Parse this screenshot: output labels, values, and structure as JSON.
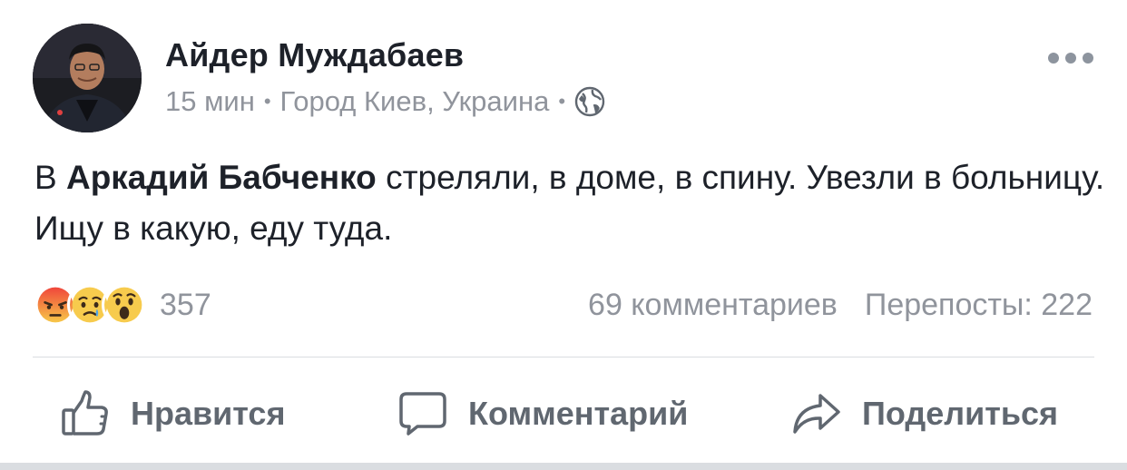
{
  "post": {
    "author": "Айдер Муждабаев",
    "time": "15 мин",
    "location": "Город Киев, Украина",
    "text_prefix": "В ",
    "tagged_name": "Аркадий Бабченко",
    "text_suffix": " стреляли, в доме, в спину. Увезли в больницу. Ищу в какую, еду туда.",
    "reaction_count": "357",
    "comments_count": "69 комментариев",
    "shares_count": "Перепосты: 222"
  },
  "actions": {
    "like": "Нравится",
    "comment": "Комментарий",
    "share": "Поделиться"
  },
  "colors": {
    "text_primary": "#1d2129",
    "text_secondary": "#90949c",
    "action_text": "#606770",
    "divider": "#dadde1"
  },
  "icons": [
    "globe-icon",
    "more-icon",
    "angry-reaction-icon",
    "sad-reaction-icon",
    "wow-reaction-icon",
    "like-icon",
    "comment-icon",
    "share-icon"
  ]
}
